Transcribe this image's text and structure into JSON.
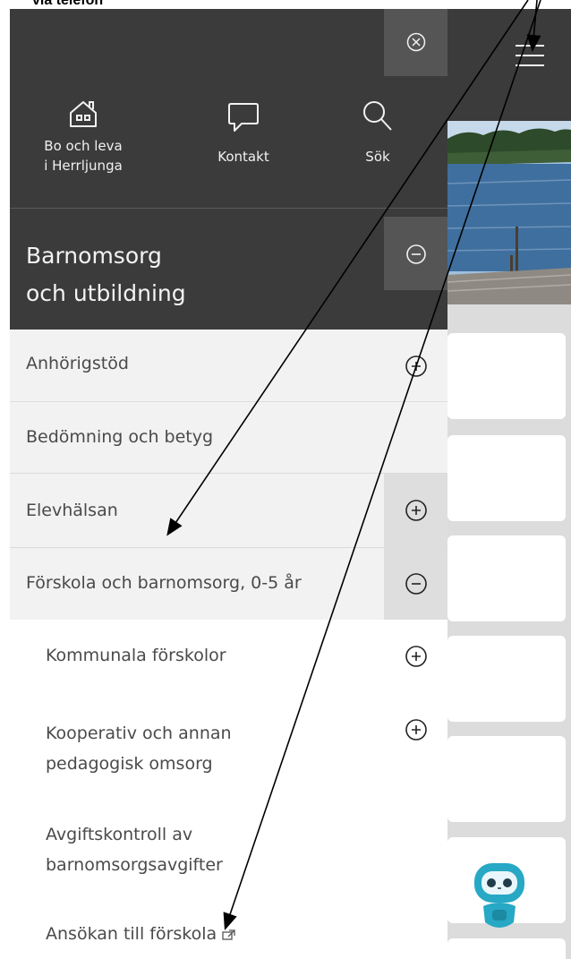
{
  "caption": "via telefon",
  "quick_links": [
    {
      "label_line1": "Bo och leva",
      "label_line2": "i Herrljunga",
      "icon": "house-icon"
    },
    {
      "label": "Kontakt",
      "icon": "chat-bubble-icon"
    },
    {
      "label": "Sök",
      "icon": "search-icon"
    }
  ],
  "section": {
    "title_line1": "Barnomsorg",
    "title_line2": "och utbildning",
    "toggle_icon": "minus-circle-icon"
  },
  "menu_items": [
    {
      "label": "Anhörigstöd",
      "toggle": "plus"
    },
    {
      "label": "Bedömning och betyg"
    },
    {
      "label": "Elevhälsan",
      "toggle": "plus"
    },
    {
      "label": "Förskola och barnomsorg, 0-5 år",
      "toggle": "minus"
    }
  ],
  "sub_items": [
    {
      "label": "Kommunala förskolor",
      "toggle": "plus"
    },
    {
      "label_line1": "Kooperativ och annan",
      "label_line2": "pedagogisk omsorg",
      "toggle": "plus"
    },
    {
      "label_line1": "Avgiftskontroll av",
      "label_line2": "barnomsorgsavgifter"
    },
    {
      "label": "Ansökan till förskola",
      "icon": "external-link-icon"
    }
  ],
  "colors": {
    "header_dark": "#3b3b3b",
    "toggle_bg": "#555555",
    "row_bg": "#f2f2f2",
    "bot_teal": "#27a8c4"
  }
}
